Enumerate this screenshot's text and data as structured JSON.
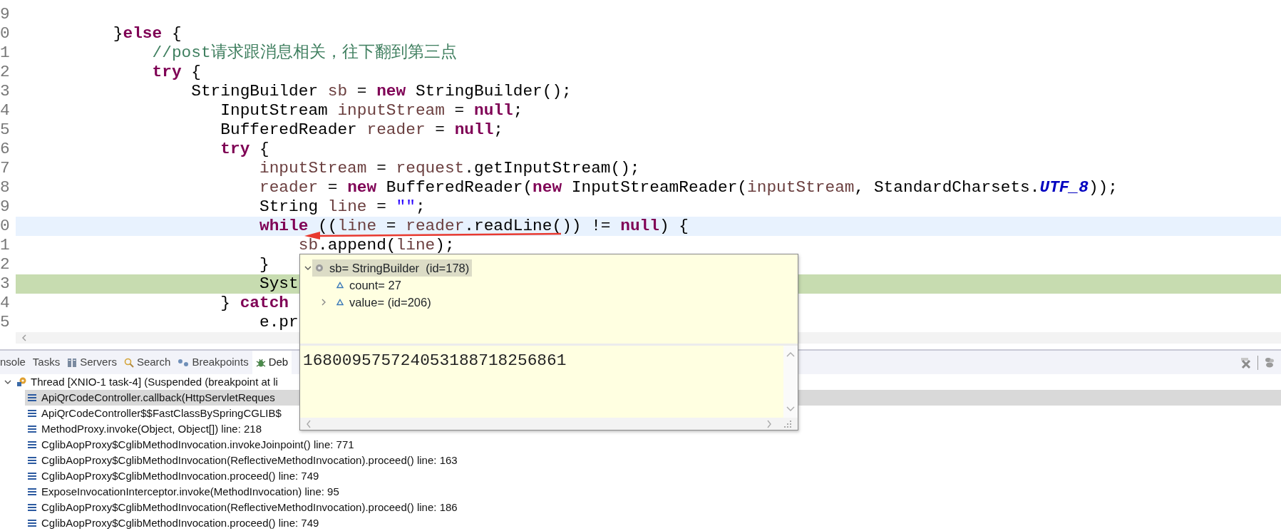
{
  "editor": {
    "lines": [
      {
        "number": "9"
      },
      {
        "number": "0",
        "tokens": [
          {
            "kind": "plain",
            "text": "}"
          },
          {
            "kind": "keyword",
            "text": "else"
          },
          {
            "kind": "plain",
            "text": " {"
          }
        ],
        "children": [
          {
            "number": "1",
            "tokens": [
              {
                "kind": "comment",
                "text": "//post请求跟消息相关，往下翻到第三点"
              }
            ]
          },
          {
            "number": "2",
            "tokens": [
              {
                "kind": "keyword",
                "text": "try"
              },
              {
                "kind": "plain",
                "text": " {"
              }
            ],
            "children": [
              {
                "number": "3",
                "tokens": [
                  {
                    "kind": "plain",
                    "text": "StringBuilder "
                  },
                  {
                    "kind": "variable",
                    "text": "sb"
                  },
                  {
                    "kind": "plain",
                    "text": " = "
                  },
                  {
                    "kind": "keyword",
                    "text": "new"
                  },
                  {
                    "kind": "plain",
                    "text": " StringBuilder();"
                  }
                ],
                "children": [
                  {
                    "number": "4",
                    "tokens": [
                      {
                        "kind": "plain",
                        "text": "InputStream "
                      },
                      {
                        "kind": "variable",
                        "text": "inputStream"
                      },
                      {
                        "kind": "plain",
                        "text": " = "
                      },
                      {
                        "kind": "keyword",
                        "text": "null"
                      },
                      {
                        "kind": "plain",
                        "text": ";"
                      }
                    ]
                  },
                  {
                    "number": "5",
                    "tokens": [
                      {
                        "kind": "plain",
                        "text": "BufferedReader "
                      },
                      {
                        "kind": "variable",
                        "text": "reader"
                      },
                      {
                        "kind": "plain",
                        "text": " = "
                      },
                      {
                        "kind": "keyword",
                        "text": "null"
                      },
                      {
                        "kind": "plain",
                        "text": ";"
                      }
                    ]
                  },
                  {
                    "number": "6",
                    "tokens": [
                      {
                        "kind": "keyword",
                        "text": "try"
                      },
                      {
                        "kind": "plain",
                        "text": " {"
                      }
                    ],
                    "children": [
                      {
                        "number": "7",
                        "tokens": [
                          {
                            "kind": "variable",
                            "text": "inputStream"
                          },
                          {
                            "kind": "plain",
                            "text": " = "
                          },
                          {
                            "kind": "variable",
                            "text": "request"
                          },
                          {
                            "kind": "plain",
                            "text": ".getInputStream();"
                          }
                        ]
                      },
                      {
                        "number": "8",
                        "tokens": [
                          {
                            "kind": "variable",
                            "text": "reader"
                          },
                          {
                            "kind": "plain",
                            "text": " = "
                          },
                          {
                            "kind": "keyword",
                            "text": "new"
                          },
                          {
                            "kind": "plain",
                            "text": " BufferedReader("
                          },
                          {
                            "kind": "keyword",
                            "text": "new"
                          },
                          {
                            "kind": "plain",
                            "text": " InputStreamReader("
                          },
                          {
                            "kind": "variable",
                            "text": "inputStream"
                          },
                          {
                            "kind": "plain",
                            "text": ", StandardCharsets."
                          },
                          {
                            "kind": "constant",
                            "text": "UTF_8"
                          },
                          {
                            "kind": "plain",
                            "text": "));"
                          }
                        ]
                      },
                      {
                        "number": "9",
                        "tokens": [
                          {
                            "kind": "plain",
                            "text": "String "
                          },
                          {
                            "kind": "variable",
                            "text": "line"
                          },
                          {
                            "kind": "plain",
                            "text": " = "
                          },
                          {
                            "kind": "string",
                            "text": "\"\""
                          },
                          {
                            "kind": "plain",
                            "text": ";"
                          }
                        ]
                      },
                      {
                        "number": "0",
                        "current": true,
                        "tokens": [
                          {
                            "kind": "keyword",
                            "text": "while"
                          },
                          {
                            "kind": "plain",
                            "text": " (("
                          },
                          {
                            "kind": "variable",
                            "text": "line"
                          },
                          {
                            "kind": "plain",
                            "text": " = "
                          },
                          {
                            "kind": "variable",
                            "text": "reader"
                          },
                          {
                            "kind": "plain",
                            "text": ".readLine()) != "
                          },
                          {
                            "kind": "keyword",
                            "text": "null"
                          },
                          {
                            "kind": "plain",
                            "text": ") {"
                          }
                        ],
                        "children": [
                          {
                            "number": "1",
                            "tokens": [
                              {
                                "kind": "variable",
                                "text": "sb"
                              },
                              {
                                "kind": "plain",
                                "text": ".append("
                              },
                              {
                                "kind": "variable",
                                "text": "line"
                              },
                              {
                                "kind": "plain",
                                "text": ");"
                              }
                            ]
                          }
                        ]
                      },
                      {
                        "number": "2",
                        "tokens": [
                          {
                            "kind": "plain",
                            "text": "}"
                          }
                        ]
                      },
                      {
                        "number": "3",
                        "suspended": true,
                        "tokens": [
                          {
                            "kind": "plain",
                            "text": "Syst"
                          }
                        ]
                      }
                    ]
                  },
                  {
                    "number": "4",
                    "tokens": [
                      {
                        "kind": "plain",
                        "text": "} "
                      },
                      {
                        "kind": "keyword",
                        "text": "catch"
                      }
                    ],
                    "children": [
                      {
                        "number": "5",
                        "tokens": [
                          {
                            "kind": "plain",
                            "text": "e.pr"
                          }
                        ]
                      }
                    ]
                  }
                ]
              }
            ]
          }
        ]
      }
    ]
  },
  "hover": {
    "tree": [
      {
        "kind": "object",
        "label": "sb= StringBuilder  (id=178)",
        "expanded": true,
        "selected": true,
        "children": [
          {
            "kind": "field",
            "label": "count= 27",
            "selected": false
          },
          {
            "kind": "field",
            "label": "value= (id=206)",
            "expanded": false,
            "selected": false
          }
        ]
      }
    ],
    "detail_value": "168009575724053188718256861"
  },
  "bottom_panel": {
    "tabs": [
      {
        "kind": "console",
        "label": "nsole",
        "selected": false
      },
      {
        "kind": "tasks",
        "label": "Tasks",
        "selected": false
      },
      {
        "kind": "servers",
        "label": "Servers",
        "selected": false
      },
      {
        "kind": "search",
        "label": "Search",
        "selected": false
      },
      {
        "kind": "breakpoints",
        "label": "Breakpoints",
        "selected": false
      },
      {
        "kind": "debug",
        "label": "Deb",
        "selected": true
      }
    ],
    "stack": [
      {
        "kind": "thread",
        "label": "Thread [XNIO-1 task-4] (Suspended (breakpoint at li",
        "expanded": true,
        "children": [
          {
            "kind": "frame",
            "label": "ApiQrCodeController.callback(HttpServletReques",
            "selected": true
          },
          {
            "kind": "frame",
            "label": "ApiQrCodeController$$FastClassBySpringCGLIB$",
            "selected": false
          },
          {
            "kind": "frame",
            "label": "MethodProxy.invoke(Object, Object[]) line: 218",
            "selected": false
          },
          {
            "kind": "frame",
            "label": "CglibAopProxy$CglibMethodInvocation.invokeJoinpoint() line: 771",
            "selected": false
          },
          {
            "kind": "frame",
            "label": "CglibAopProxy$CglibMethodInvocation(ReflectiveMethodInvocation).proceed() line: 163",
            "selected": false
          },
          {
            "kind": "frame",
            "label": "CglibAopProxy$CglibMethodInvocation.proceed() line: 749",
            "selected": false
          },
          {
            "kind": "frame",
            "label": "ExposeInvocationInterceptor.invoke(MethodInvocation) line: 95",
            "selected": false
          },
          {
            "kind": "frame",
            "label": "CglibAopProxy$CglibMethodInvocation(ReflectiveMethodInvocation).proceed() line: 186",
            "selected": false
          },
          {
            "kind": "frame",
            "label": "CglibAopProxy$CglibMethodInvocation.proceed() line: 749",
            "selected": false
          }
        ]
      }
    ]
  }
}
